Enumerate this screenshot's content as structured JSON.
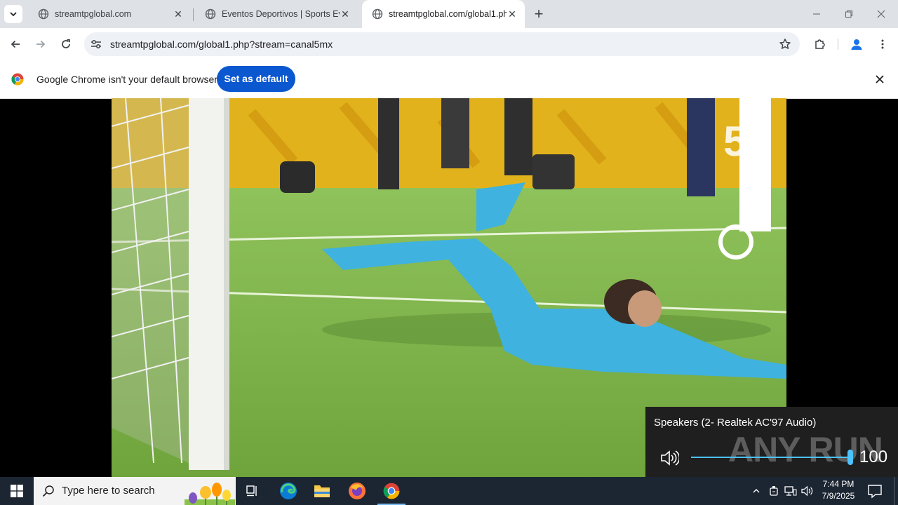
{
  "browser": {
    "tabs": [
      {
        "title": "streamtpglobal.com",
        "active": false
      },
      {
        "title": "Eventos Deportivos | Sports Eve",
        "active": false
      },
      {
        "title": "streamtpglobal.com/global1.ph",
        "active": true
      }
    ],
    "url": "streamtpglobal.com/global1.php?stream=canal5mx"
  },
  "infobar": {
    "message": "Google Chrome isn't your default browser",
    "button_label": "Set as default"
  },
  "video": {
    "channel_logo": "5"
  },
  "volume_flyout": {
    "device": "Speakers (2- Realtek AC'97 Audio)",
    "level": "100",
    "level_fraction": 1.0,
    "watermark": "ANY RUN"
  },
  "taskbar": {
    "search_placeholder": "Type here to search",
    "time": "7:44 PM",
    "date": "7/9/2025"
  },
  "colors": {
    "accent": "#0b57d0",
    "volume": "#4cc2ff",
    "taskbar": "#1c2532"
  }
}
